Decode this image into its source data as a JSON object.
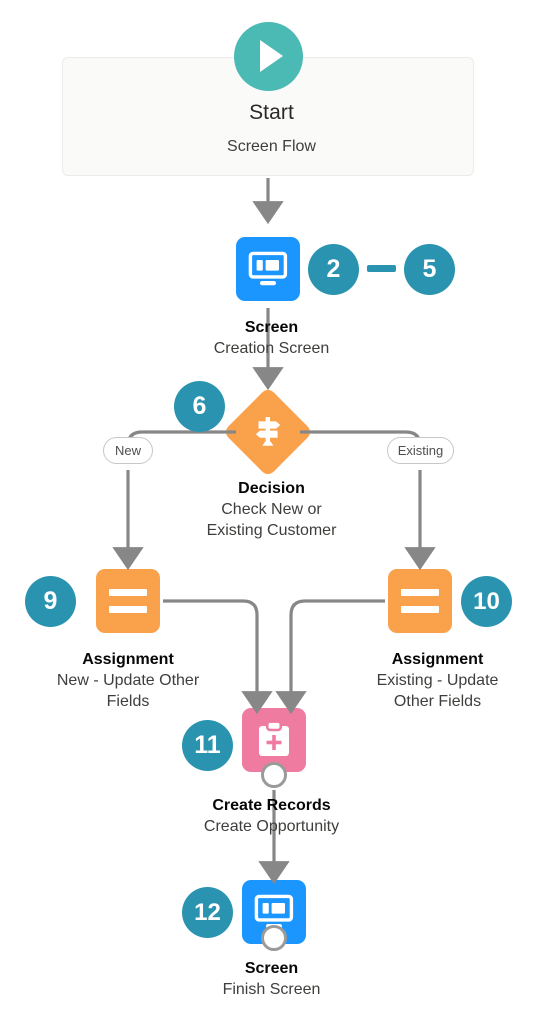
{
  "diagram": {
    "type": "salesforce-flow-builder",
    "colors": {
      "start_accent": "#4bb9b4",
      "screen": "#1b96ff",
      "assignment": "#f9a14b",
      "decision": "#f9a14b",
      "create_records": "#ef7ba0",
      "badge": "#2a94b0",
      "connector": "#878787",
      "start_box_bg": "#fafaf9"
    },
    "start": {
      "icon": "play-icon",
      "title": "Start",
      "subtitle": "Screen Flow"
    },
    "nodes": [
      {
        "id": "screen-creation",
        "icon": "screen-icon",
        "title": "Screen",
        "subtitle": "Creation Screen",
        "badges": [
          "2",
          "5"
        ]
      },
      {
        "id": "decision",
        "icon": "decision-signpost-icon",
        "title": "Decision",
        "subtitle_line1": "Check New or",
        "subtitle_line2": "Existing Customer",
        "badges": [
          "6"
        ],
        "branches": [
          "New",
          "Existing"
        ]
      },
      {
        "id": "assignment-new",
        "icon": "assignment-icon",
        "title": "Assignment",
        "subtitle_line1": "New - Update Other",
        "subtitle_line2": "Fields",
        "badges": [
          "9"
        ]
      },
      {
        "id": "assignment-existing",
        "icon": "assignment-icon",
        "title": "Assignment",
        "subtitle_line1": "Existing - Update",
        "subtitle_line2": "Other Fields",
        "badges": [
          "10"
        ]
      },
      {
        "id": "create-records",
        "icon": "create-records-icon",
        "title": "Create Records",
        "subtitle": "Create Opportunity",
        "badges": [
          "11"
        ]
      },
      {
        "id": "screen-finish",
        "icon": "screen-icon",
        "title": "Screen",
        "subtitle": "Finish Screen",
        "badges": [
          "12"
        ]
      }
    ]
  }
}
